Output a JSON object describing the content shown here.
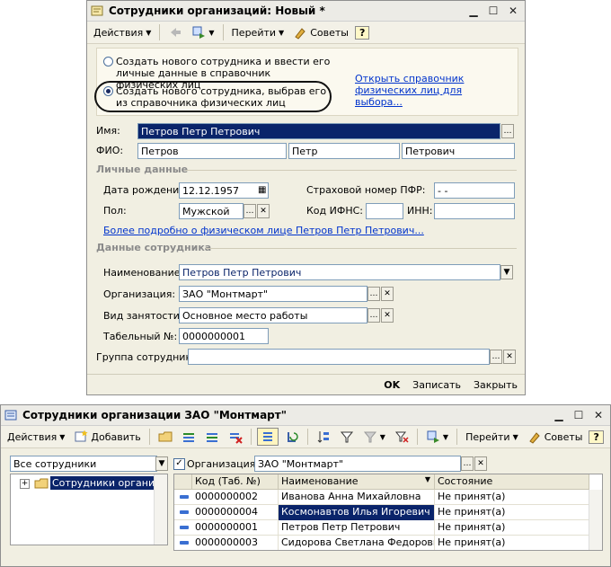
{
  "form": {
    "title": "Сотрудники организаций: Новый *",
    "toolbar": {
      "actions": "Действия",
      "goto": "Перейти",
      "tips": "Советы",
      "help": "?"
    },
    "option1": "Создать нового сотрудника и ввести его личные данные в справочник физических лиц",
    "option2": "Создать нового сотрудника, выбрав его из справочника физических лиц",
    "open_ref_link": "Открыть справочник физических лиц для выбора...",
    "name_label": "Имя:",
    "name_value": "Петров Петр Петрович",
    "fio_label": "ФИО:",
    "fio_last": "Петров",
    "fio_first": "Петр",
    "fio_middle": "Петрович",
    "personal_group": "Личные данные",
    "dob_label": "Дата рождения:",
    "dob_value": "12.12.1957",
    "pfr_label": "Страховой номер ПФР:",
    "pfr_value": " -  - ",
    "gender_label": "Пол:",
    "gender_value": "Мужской",
    "ifns_label": "Код ИФНС:",
    "ifns_value": "",
    "inn_label": "ИНН:",
    "inn_value": "",
    "more_link": "Более подробно о физическом лице Петров Петр Петрович...",
    "employee_group": "Данные сотрудника",
    "naim_label": "Наименование:",
    "naim_value": "Петров Петр Петрович",
    "org_label": "Организация:",
    "org_value": "ЗАО \"Монтмарт\"",
    "work_label": "Вид занятости:",
    "work_value": "Основное место работы",
    "tab_label": "Табельный №:",
    "tab_value": "0000000001",
    "group_label": "Группа сотрудника:",
    "group_value": "",
    "ok": "OK",
    "save": "Записать",
    "close": "Закрыть"
  },
  "list": {
    "title": "Сотрудники организации ЗАО \"Монтмарт\"",
    "toolbar": {
      "actions": "Действия",
      "add": "Добавить",
      "goto": "Перейти",
      "tips": "Советы",
      "help": "?"
    },
    "filter_value": "Все сотрудники",
    "tree_item": "Сотрудники организаци",
    "org_check_label": "Организация:",
    "org_value": "ЗАО \"Монтмарт\"",
    "columns": [
      "Код (Таб. №)",
      "Наименование",
      "Состояние"
    ],
    "rows": [
      {
        "code": "0000000002",
        "name": "Иванова Анна Михайловна",
        "state": "Не принят(а)"
      },
      {
        "code": "0000000004",
        "name": "Космонавтов Илья Игоревич",
        "state": "Не принят(а)"
      },
      {
        "code": "0000000001",
        "name": "Петров Петр Петрович",
        "state": "Не принят(а)"
      },
      {
        "code": "0000000003",
        "name": "Сидорова Светлана Федоровна",
        "state": "Не принят(а)"
      }
    ]
  }
}
